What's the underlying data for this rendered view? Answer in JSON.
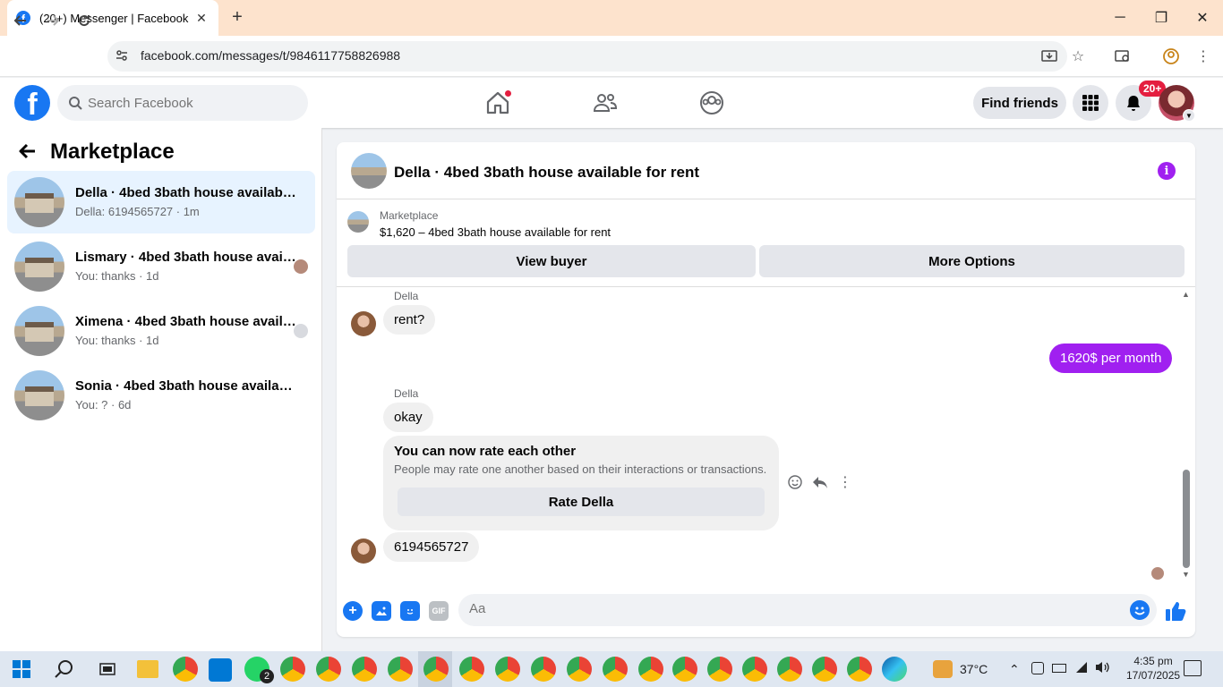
{
  "browser": {
    "tab_title": "(20+) Messenger | Facebook",
    "url": "facebook.com/messages/t/9846117758826988"
  },
  "header": {
    "search_placeholder": "Search Facebook",
    "find_friends": "Find friends",
    "notification_count": "20+"
  },
  "sidebar": {
    "title": "Marketplace",
    "conversations": [
      {
        "name": "Della · 4bed 3bath house available for rent",
        "preview": "Della: 6194565727 · 1m",
        "active": true
      },
      {
        "name": "Lismary · 4bed 3bath house available for rent",
        "preview": "You: thanks · 1d"
      },
      {
        "name": "Ximena · 4bed 3bath house available for rent",
        "preview": "You: thanks · 1d"
      },
      {
        "name": "Sonia · 4bed 3bath house available for rent",
        "preview": "You: ? · 6d"
      }
    ]
  },
  "chat": {
    "title": "Della · 4bed 3bath house available for rent",
    "marketplace_label": "Marketplace",
    "listing": "$1,620 – 4bed 3bath house available for rent",
    "view_buyer": "View buyer",
    "more_options": "More Options",
    "messages": {
      "m1_sender": "Della",
      "m1_text": "rent?",
      "m2_text": "1620$ per month",
      "m3_sender": "Della",
      "m3_text": "okay",
      "rate_title": "You can now rate each other",
      "rate_desc": "People may rate one another based on their interactions or transactions.",
      "rate_button": "Rate Della",
      "m4_text": "6194565727"
    },
    "composer_placeholder": "Aa"
  },
  "taskbar": {
    "temperature": "37°C",
    "time": "4:35 pm",
    "date": "17/07/2025",
    "whatsapp_badge": "2"
  },
  "colors": {
    "accent_purple": "#a020f0",
    "fb_blue": "#1877f2"
  }
}
